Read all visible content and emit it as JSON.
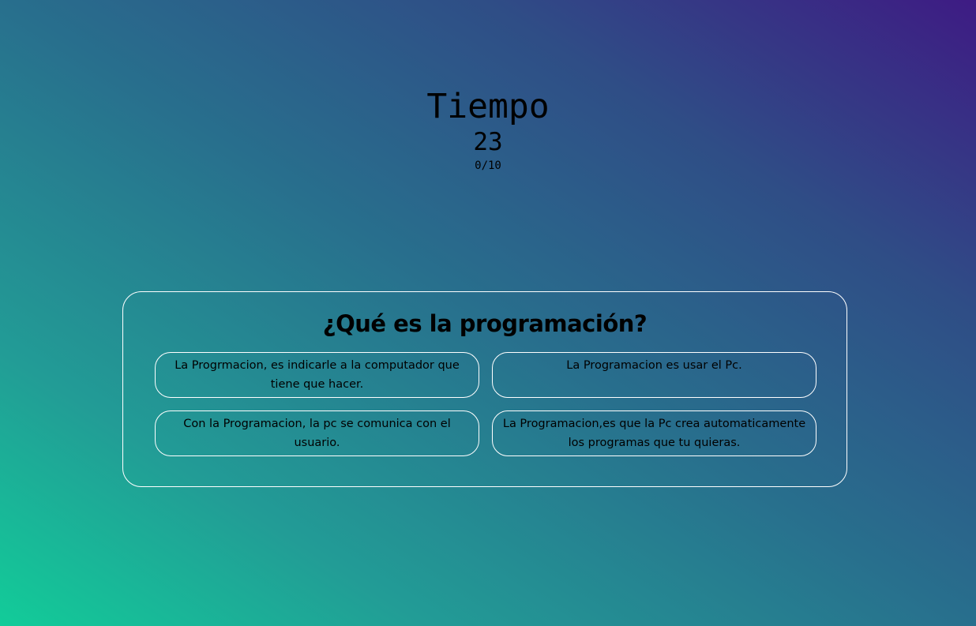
{
  "timer": {
    "label": "Tiempo",
    "seconds": "23",
    "score": "0/10"
  },
  "quiz": {
    "question": "¿Qué es la programación?",
    "answers": [
      "La Progrmacion, es indicarle a la computador que tiene que hacer.",
      "La Programacion es usar el Pc.",
      "Con la Programacion, la pc se comunica con el usuario.",
      "La Programacion,es que la Pc crea automaticamente los programas que tu quieras."
    ]
  },
  "colors": {
    "gradient_bottom_left": "#12cc99",
    "gradient_top_right": "#3e1b84",
    "border": "#ffffff",
    "text": "#000000"
  }
}
